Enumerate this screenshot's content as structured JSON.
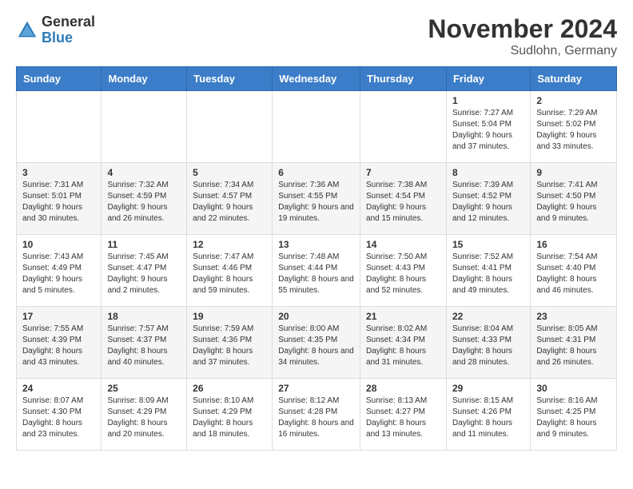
{
  "header": {
    "logo_general": "General",
    "logo_blue": "Blue",
    "month_title": "November 2024",
    "location": "Sudlohn, Germany"
  },
  "days_of_week": [
    "Sunday",
    "Monday",
    "Tuesday",
    "Wednesday",
    "Thursday",
    "Friday",
    "Saturday"
  ],
  "weeks": [
    [
      {
        "day": "",
        "info": ""
      },
      {
        "day": "",
        "info": ""
      },
      {
        "day": "",
        "info": ""
      },
      {
        "day": "",
        "info": ""
      },
      {
        "day": "",
        "info": ""
      },
      {
        "day": "1",
        "info": "Sunrise: 7:27 AM\nSunset: 5:04 PM\nDaylight: 9 hours and 37 minutes."
      },
      {
        "day": "2",
        "info": "Sunrise: 7:29 AM\nSunset: 5:02 PM\nDaylight: 9 hours and 33 minutes."
      }
    ],
    [
      {
        "day": "3",
        "info": "Sunrise: 7:31 AM\nSunset: 5:01 PM\nDaylight: 9 hours and 30 minutes."
      },
      {
        "day": "4",
        "info": "Sunrise: 7:32 AM\nSunset: 4:59 PM\nDaylight: 9 hours and 26 minutes."
      },
      {
        "day": "5",
        "info": "Sunrise: 7:34 AM\nSunset: 4:57 PM\nDaylight: 9 hours and 22 minutes."
      },
      {
        "day": "6",
        "info": "Sunrise: 7:36 AM\nSunset: 4:55 PM\nDaylight: 9 hours and 19 minutes."
      },
      {
        "day": "7",
        "info": "Sunrise: 7:38 AM\nSunset: 4:54 PM\nDaylight: 9 hours and 15 minutes."
      },
      {
        "day": "8",
        "info": "Sunrise: 7:39 AM\nSunset: 4:52 PM\nDaylight: 9 hours and 12 minutes."
      },
      {
        "day": "9",
        "info": "Sunrise: 7:41 AM\nSunset: 4:50 PM\nDaylight: 9 hours and 9 minutes."
      }
    ],
    [
      {
        "day": "10",
        "info": "Sunrise: 7:43 AM\nSunset: 4:49 PM\nDaylight: 9 hours and 5 minutes."
      },
      {
        "day": "11",
        "info": "Sunrise: 7:45 AM\nSunset: 4:47 PM\nDaylight: 9 hours and 2 minutes."
      },
      {
        "day": "12",
        "info": "Sunrise: 7:47 AM\nSunset: 4:46 PM\nDaylight: 8 hours and 59 minutes."
      },
      {
        "day": "13",
        "info": "Sunrise: 7:48 AM\nSunset: 4:44 PM\nDaylight: 8 hours and 55 minutes."
      },
      {
        "day": "14",
        "info": "Sunrise: 7:50 AM\nSunset: 4:43 PM\nDaylight: 8 hours and 52 minutes."
      },
      {
        "day": "15",
        "info": "Sunrise: 7:52 AM\nSunset: 4:41 PM\nDaylight: 8 hours and 49 minutes."
      },
      {
        "day": "16",
        "info": "Sunrise: 7:54 AM\nSunset: 4:40 PM\nDaylight: 8 hours and 46 minutes."
      }
    ],
    [
      {
        "day": "17",
        "info": "Sunrise: 7:55 AM\nSunset: 4:39 PM\nDaylight: 8 hours and 43 minutes."
      },
      {
        "day": "18",
        "info": "Sunrise: 7:57 AM\nSunset: 4:37 PM\nDaylight: 8 hours and 40 minutes."
      },
      {
        "day": "19",
        "info": "Sunrise: 7:59 AM\nSunset: 4:36 PM\nDaylight: 8 hours and 37 minutes."
      },
      {
        "day": "20",
        "info": "Sunrise: 8:00 AM\nSunset: 4:35 PM\nDaylight: 8 hours and 34 minutes."
      },
      {
        "day": "21",
        "info": "Sunrise: 8:02 AM\nSunset: 4:34 PM\nDaylight: 8 hours and 31 minutes."
      },
      {
        "day": "22",
        "info": "Sunrise: 8:04 AM\nSunset: 4:33 PM\nDaylight: 8 hours and 28 minutes."
      },
      {
        "day": "23",
        "info": "Sunrise: 8:05 AM\nSunset: 4:31 PM\nDaylight: 8 hours and 26 minutes."
      }
    ],
    [
      {
        "day": "24",
        "info": "Sunrise: 8:07 AM\nSunset: 4:30 PM\nDaylight: 8 hours and 23 minutes."
      },
      {
        "day": "25",
        "info": "Sunrise: 8:09 AM\nSunset: 4:29 PM\nDaylight: 8 hours and 20 minutes."
      },
      {
        "day": "26",
        "info": "Sunrise: 8:10 AM\nSunset: 4:29 PM\nDaylight: 8 hours and 18 minutes."
      },
      {
        "day": "27",
        "info": "Sunrise: 8:12 AM\nSunset: 4:28 PM\nDaylight: 8 hours and 16 minutes."
      },
      {
        "day": "28",
        "info": "Sunrise: 8:13 AM\nSunset: 4:27 PM\nDaylight: 8 hours and 13 minutes."
      },
      {
        "day": "29",
        "info": "Sunrise: 8:15 AM\nSunset: 4:26 PM\nDaylight: 8 hours and 11 minutes."
      },
      {
        "day": "30",
        "info": "Sunrise: 8:16 AM\nSunset: 4:25 PM\nDaylight: 8 hours and 9 minutes."
      }
    ]
  ]
}
